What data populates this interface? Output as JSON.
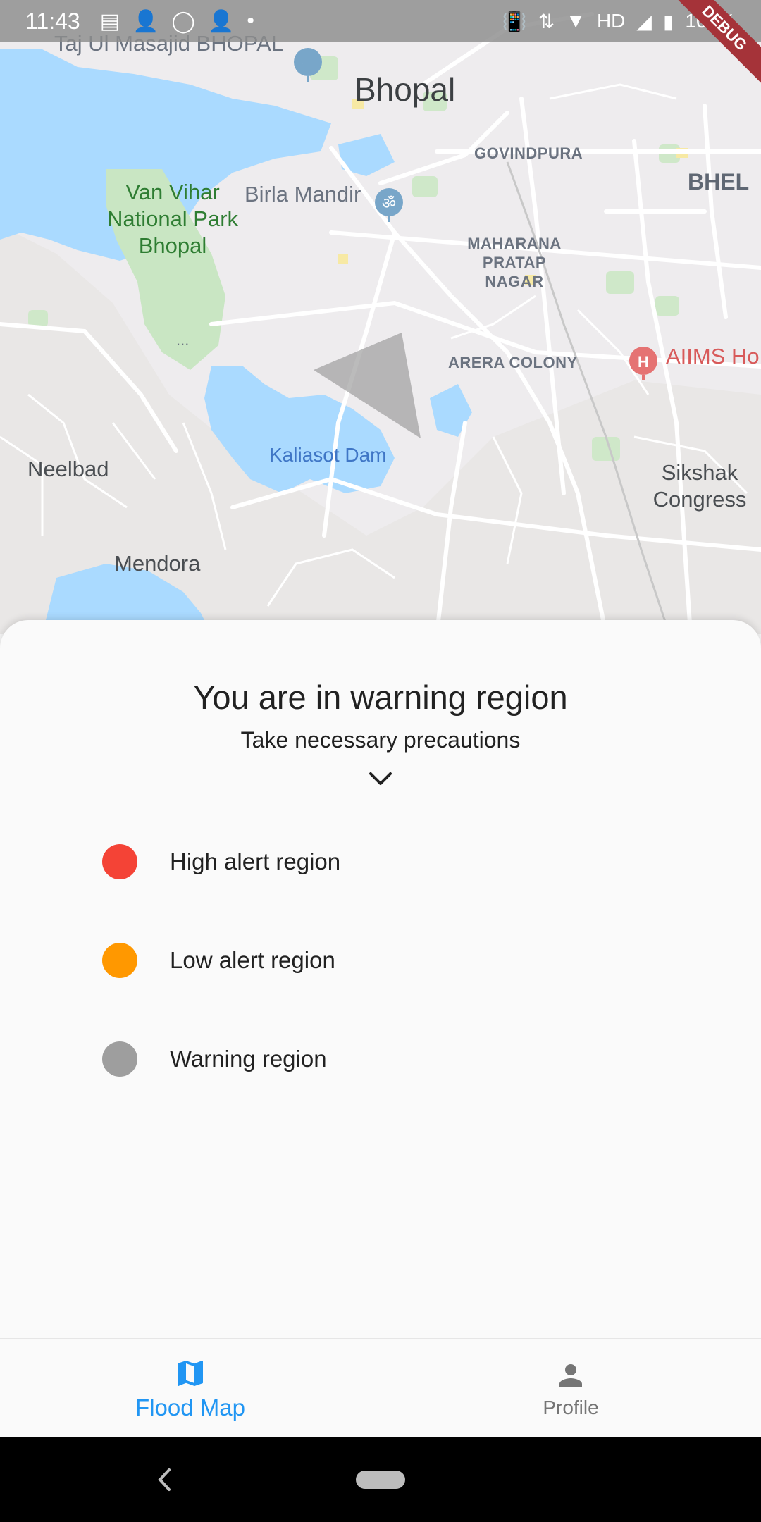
{
  "status_bar": {
    "time": "11:43",
    "network": "HD",
    "battery": "100%",
    "debug_banner": "DEBUG"
  },
  "map": {
    "labels": {
      "taj_ul_masajid": "Taj Ul Masajid BHOPAL",
      "bhopal": "Bhopal",
      "govindpura": "GOVINDPURA",
      "bhel": "BHEL",
      "van_vihar": "Van Vihar National Park Bhopal",
      "birla_mandir": "Birla Mandir",
      "maharana": "MAHARANA PRATAP NAGAR",
      "arera_colony": "ARERA COLONY",
      "aiims": "AIIMS Ho",
      "neelbad": "Neelbad",
      "kaliasot": "Kaliasot Dam",
      "sikshak": "Sikshak Congress",
      "mendora": "Mendora",
      "ellipsis": "..."
    }
  },
  "sheet": {
    "title": "You are in warning region",
    "subtitle": "Take necessary precautions",
    "legend": [
      {
        "label": "High alert region",
        "color": "#f44336"
      },
      {
        "label": "Low alert region",
        "color": "#ff9800"
      },
      {
        "label": "Warning region",
        "color": "#9e9e9e"
      }
    ]
  },
  "bottom_nav": {
    "items": [
      {
        "label": "Flood Map",
        "icon": "map-icon",
        "active": true
      },
      {
        "label": "Profile",
        "icon": "person-icon",
        "active": false
      }
    ]
  },
  "colors": {
    "accent": "#2196f3",
    "warning_overlay": "#9e9e9e",
    "water": "#aadaff"
  }
}
